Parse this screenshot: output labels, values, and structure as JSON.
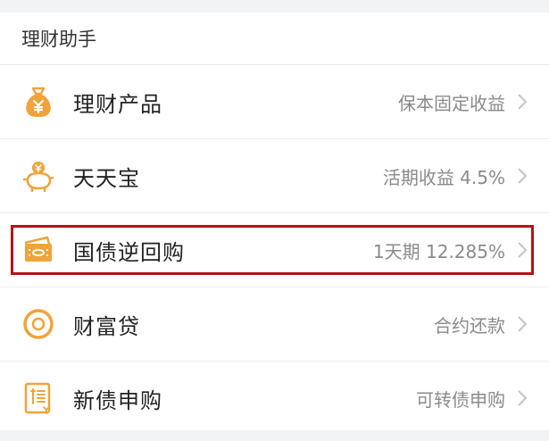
{
  "section": {
    "title": "理财助手"
  },
  "accent_color": "#f0a33b",
  "highlight_color": "#b31217",
  "items": [
    {
      "icon": "money-bag-icon",
      "title": "理财产品",
      "meta": "保本固定收益"
    },
    {
      "icon": "piggy-bank-icon",
      "title": "天天宝",
      "meta": "活期收益 4.5%"
    },
    {
      "icon": "ticket-icon",
      "title": "国债逆回购",
      "meta": "1天期 12.285%",
      "highlighted": true
    },
    {
      "icon": "coin-ring-icon",
      "title": "财富贷",
      "meta": "合约还款"
    },
    {
      "icon": "bond-document-icon",
      "title": "新债申购",
      "meta": "可转债申购"
    }
  ]
}
